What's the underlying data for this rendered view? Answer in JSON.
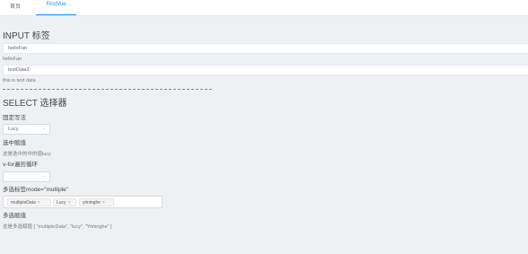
{
  "nav": {
    "tabs": [
      {
        "label": "首页"
      },
      {
        "label": "FirstVue"
      }
    ]
  },
  "input_section": {
    "heading": "INPUT 标签",
    "field1": {
      "value": "helloFan"
    },
    "echo1": "helloFan",
    "field2": {
      "value": "testData2"
    },
    "echo2": "this is test data"
  },
  "select_section": {
    "heading": "SELECT 选择器",
    "fixed_label": "固定写法",
    "fixed_select": {
      "value": "Lucy"
    },
    "selected_label": "选中赋值",
    "selected_text": "这是选中的中的值lucy",
    "vfor_label": "v-for遍历循环",
    "vfor_select": {
      "value": ""
    },
    "multi_label": "多选标签mode=\"multiple\"",
    "multi_chips": [
      {
        "label": "multipleData"
      },
      {
        "label": "Lucy"
      },
      {
        "label": "yiminghe"
      }
    ],
    "multi_assign_label": "多选赋值",
    "multi_assign_text": "这是多选赋值 [ \"multipleData\", \"lucy\", \"Yiminghe\" ]"
  }
}
